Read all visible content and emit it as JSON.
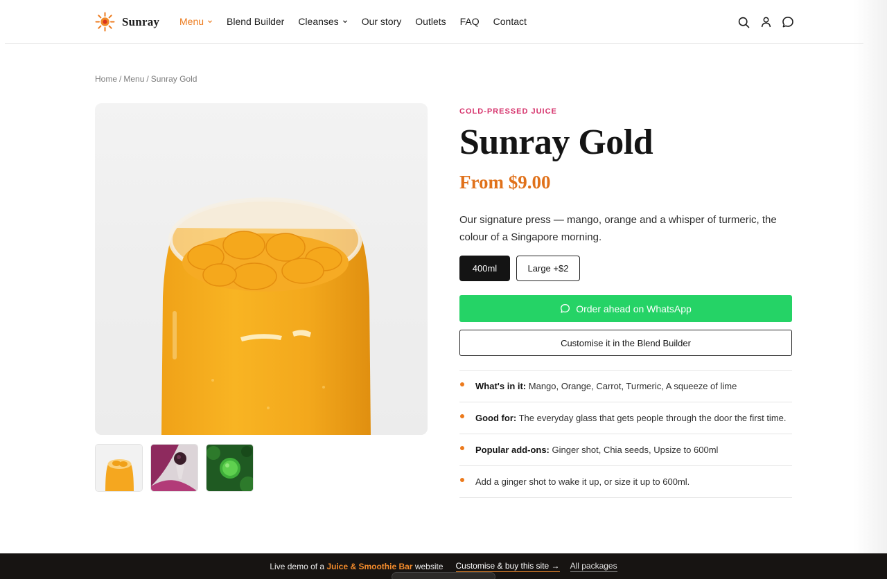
{
  "brand": {
    "name": "Sunray",
    "accent": "#ec7a1c"
  },
  "nav": {
    "items": [
      {
        "label": "Menu",
        "active": true,
        "has_dropdown": true
      },
      {
        "label": "Blend Builder",
        "active": false,
        "has_dropdown": false
      },
      {
        "label": "Cleanses",
        "active": false,
        "has_dropdown": true
      },
      {
        "label": "Our story",
        "active": false,
        "has_dropdown": false
      },
      {
        "label": "Outlets",
        "active": false,
        "has_dropdown": false
      },
      {
        "label": "FAQ",
        "active": false,
        "has_dropdown": false
      },
      {
        "label": "Contact",
        "active": false,
        "has_dropdown": false
      }
    ],
    "icons": [
      "search-icon",
      "user-icon",
      "chat-icon"
    ]
  },
  "breadcrumb": {
    "home": "Home",
    "menu": "Menu",
    "current": "Sunray Gold",
    "separator": "/"
  },
  "product": {
    "eyebrow": "COLD-PRESSED JUICE",
    "title": "Sunray Gold",
    "price": "From $9.00",
    "description": "Our signature press — mango, orange and a whisper of turmeric, the colour of a Singapore morning.",
    "sizes": [
      {
        "label": "400ml",
        "selected": true
      },
      {
        "label": "Large +$2",
        "selected": false
      }
    ],
    "whatsapp_label": "Order ahead on WhatsApp",
    "blend_label": "Customise it in the Blend Builder",
    "details": [
      {
        "label": "What's in it:",
        "text": "Mango, Orange, Carrot, Turmeric, A squeeze of lime"
      },
      {
        "label": "Good for:",
        "text": "The everyday glass that gets people through the door the first time."
      },
      {
        "label": "Popular add-ons:",
        "text": "Ginger shot, Chia seeds, Upsize to 600ml"
      },
      {
        "label": "",
        "text": "Add a ginger shot to wake it up, or size it up to 600ml."
      }
    ],
    "thumbnails": [
      "mango-juice-jar",
      "berry-smoothie",
      "green-juice"
    ]
  },
  "colors": {
    "eyebrow": "#d6336c",
    "price": "#e0711a",
    "whatsapp": "#25d366",
    "dark": "#141414"
  },
  "banner": {
    "prefix": "Live demo of a",
    "highlight": "Juice & Smoothie Bar",
    "suffix": "website",
    "cta": "Customise & buy this site →",
    "packages": "All packages"
  }
}
